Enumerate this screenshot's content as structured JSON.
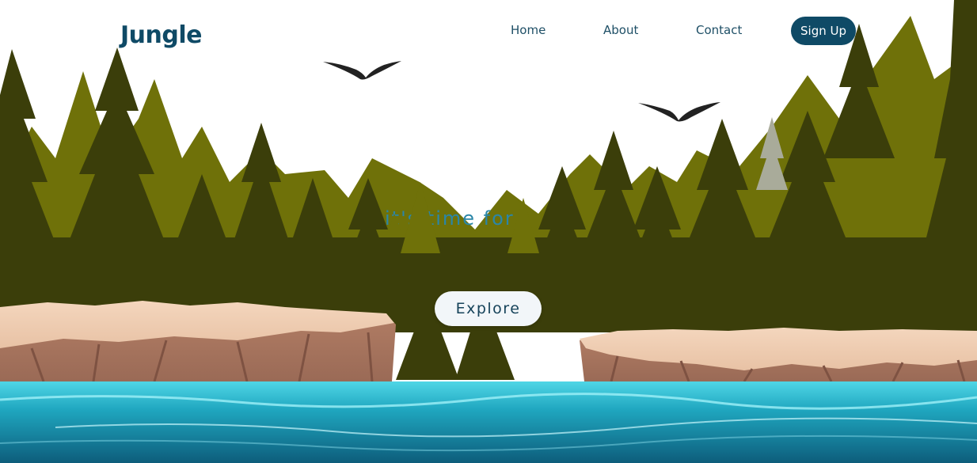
{
  "brand": {
    "name": "Jungle"
  },
  "nav": {
    "items": [
      {
        "label": "Home"
      },
      {
        "label": "About"
      },
      {
        "label": "Contact"
      }
    ],
    "signup_label": "Sign Up"
  },
  "hero": {
    "tagline_visible": "it's time for",
    "cta_label": "Explore"
  },
  "colors": {
    "brand": "#0f4a66",
    "tree_dark": "#3b3e0a",
    "tree_olive": "#6f7109",
    "cliff": "#c99a80",
    "water": "#1e9bb4"
  }
}
